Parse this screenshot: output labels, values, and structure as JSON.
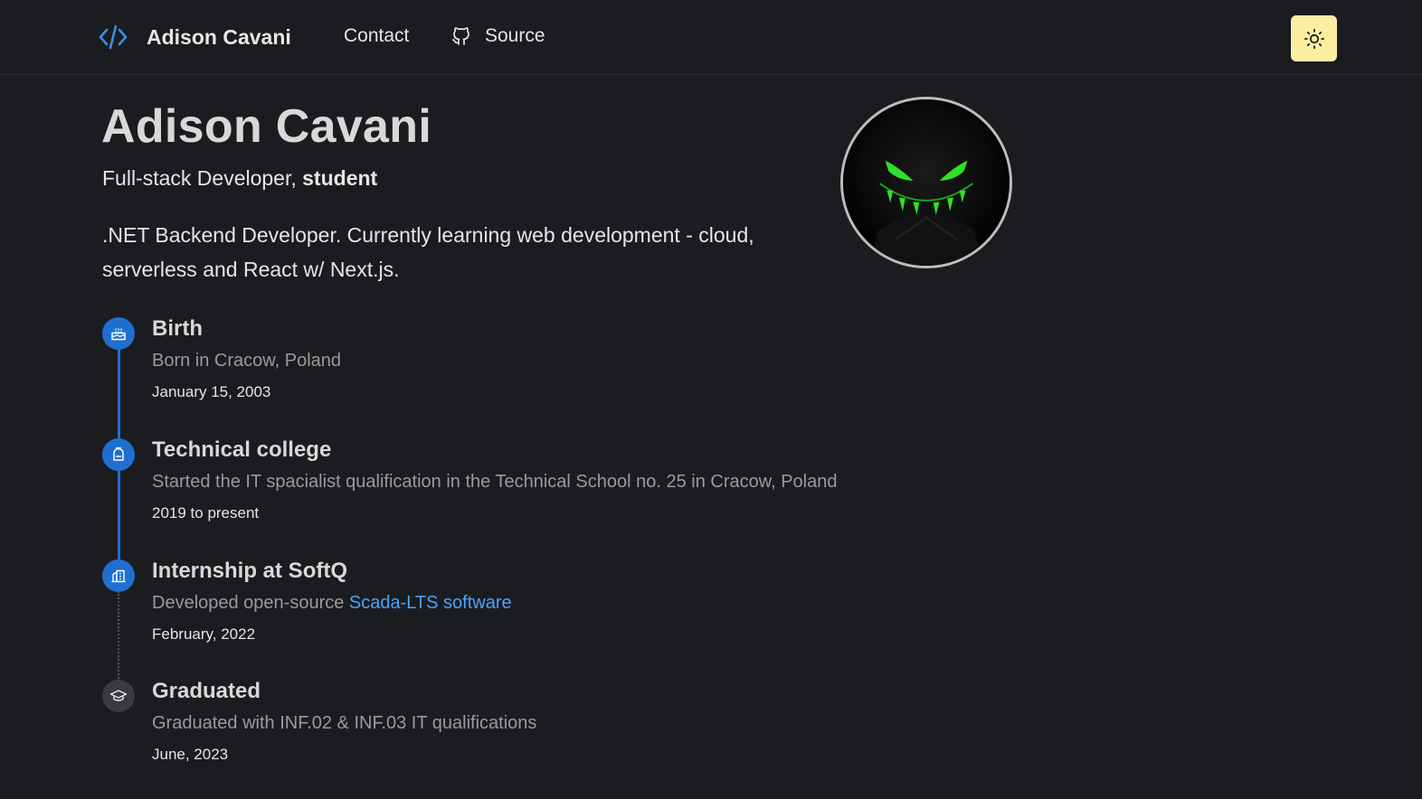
{
  "header": {
    "brand_name": "Adison Cavani",
    "nav": [
      {
        "label": "Contact"
      },
      {
        "label": "Source",
        "icon": "github-icon"
      }
    ],
    "theme_toggle_icon": "sun-icon",
    "theme_toggle_color": "#fbeea0"
  },
  "hero": {
    "title": "Adison Cavani",
    "subtitle_prefix": "Full-stack Developer, ",
    "subtitle_bold": "student",
    "bio": ".NET Backend Developer. Currently learning web development - cloud, serverless and React w/ Next.js.",
    "avatar_icon": "grinning-shadow-avatar"
  },
  "timeline": {
    "accent_color": "#1f6fd1",
    "items": [
      {
        "title": "Birth",
        "description": "Born in Cracow, Poland",
        "date": "January 15, 2003",
        "icon": "cake-icon"
      },
      {
        "title": "Technical college",
        "description": "Started the IT spacialist qualification in the Technical School no. 25 in Cracow, Poland",
        "date": "2019 to present",
        "icon": "school-bag-icon"
      },
      {
        "title": "Internship at SoftQ",
        "description_prefix": "Developed open-source ",
        "description_link": "Scada-LTS software",
        "date": "February, 2022",
        "icon": "building-icon"
      },
      {
        "title": "Graduated",
        "description": "Graduated with INF.02 & INF.03 IT qualifications",
        "date": "June, 2023",
        "icon": "graduation-cap-icon"
      }
    ]
  }
}
